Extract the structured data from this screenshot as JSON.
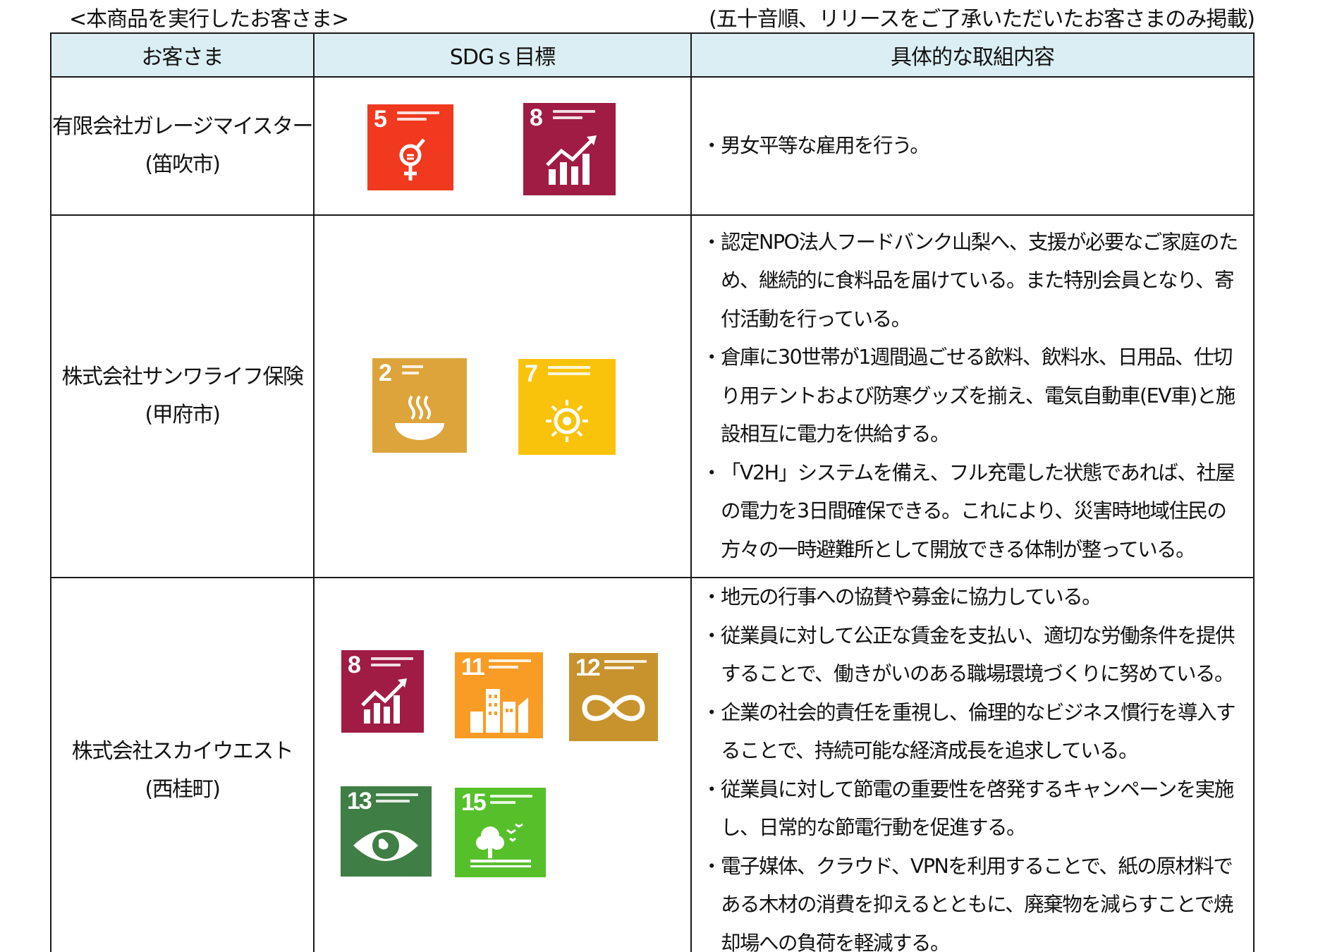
{
  "caption": {
    "left": "<本商品を実行したお客さま>",
    "right": "(五十音順、リリースをご了承いただいたお客さまのみ掲載)"
  },
  "table": {
    "headers": [
      "お客さま",
      "SDGｓ目標",
      "具体的な取組内容"
    ],
    "rows": [
      {
        "name": "有限会社ガレージマイスター",
        "city": "(笛吹市)",
        "goals": [
          {
            "number": "5",
            "icon": "gender-equality-icon",
            "color": "#f0391f"
          },
          {
            "number": "8",
            "icon": "growth-chart-icon",
            "color": "#a01c45"
          }
        ],
        "bullets": [
          "男女平等な雇用を行う。"
        ]
      },
      {
        "name": "株式会社サンワライフ保険",
        "city": "(甲府市)",
        "goals": [
          {
            "number": "2",
            "icon": "food-bowl-icon",
            "color": "#dca43a"
          },
          {
            "number": "7",
            "icon": "sun-energy-icon",
            "color": "#f9c30b"
          }
        ],
        "bullets": [
          "認定NPO法人フードバンク山梨へ、支援が必要なご家庭のため、継続的に食料品を届けている。また特別会員となり、寄付活動を行っている。",
          "倉庫に30世帯が1週間過ごせる飲料、飲料水、日用品、仕切り用テントおよび防寒グッズを揃え、電気自動車(EV車)と施設相互に電力を供給する。",
          "「V2H」システムを備え、フル充電した状態であれば、社屋の電力を3日間確保できる。これにより、災害時地域住民の方々の一時避難所として開放できる体制が整っている。"
        ]
      },
      {
        "name": "株式会社スカイウエスト",
        "city": "(西桂町)",
        "goals": [
          {
            "number": "8",
            "icon": "growth-chart-icon",
            "color": "#a01c45"
          },
          {
            "number": "11",
            "icon": "city-buildings-icon",
            "color": "#f99c26"
          },
          {
            "number": "12",
            "icon": "infinity-icon",
            "color": "#c8922d"
          },
          {
            "number": "13",
            "icon": "earth-eye-icon",
            "color": "#3f7e44"
          },
          {
            "number": "15",
            "icon": "tree-birds-icon",
            "color": "#56c02b"
          }
        ],
        "bullets": [
          "地元の行事への協賛や募金に協力している。",
          "従業員に対して公正な賃金を支払い、適切な労働条件を提供することで、働きがいのある職場環境づくりに努めている。",
          "企業の社会的責任を重視し、倫理的なビジネス慣行を導入することで、持続可能な経済成長を追求している。",
          "従業員に対して節電の重要性を啓発するキャンペーンを実施し、日常的な節電行動を促進する。",
          "電子媒体、クラウド、VPNを利用することで、紙の原材料である木材の消費を抑えるとともに、廃棄物を減らすことで焼却場への負荷を軽減する。"
        ]
      }
    ]
  }
}
